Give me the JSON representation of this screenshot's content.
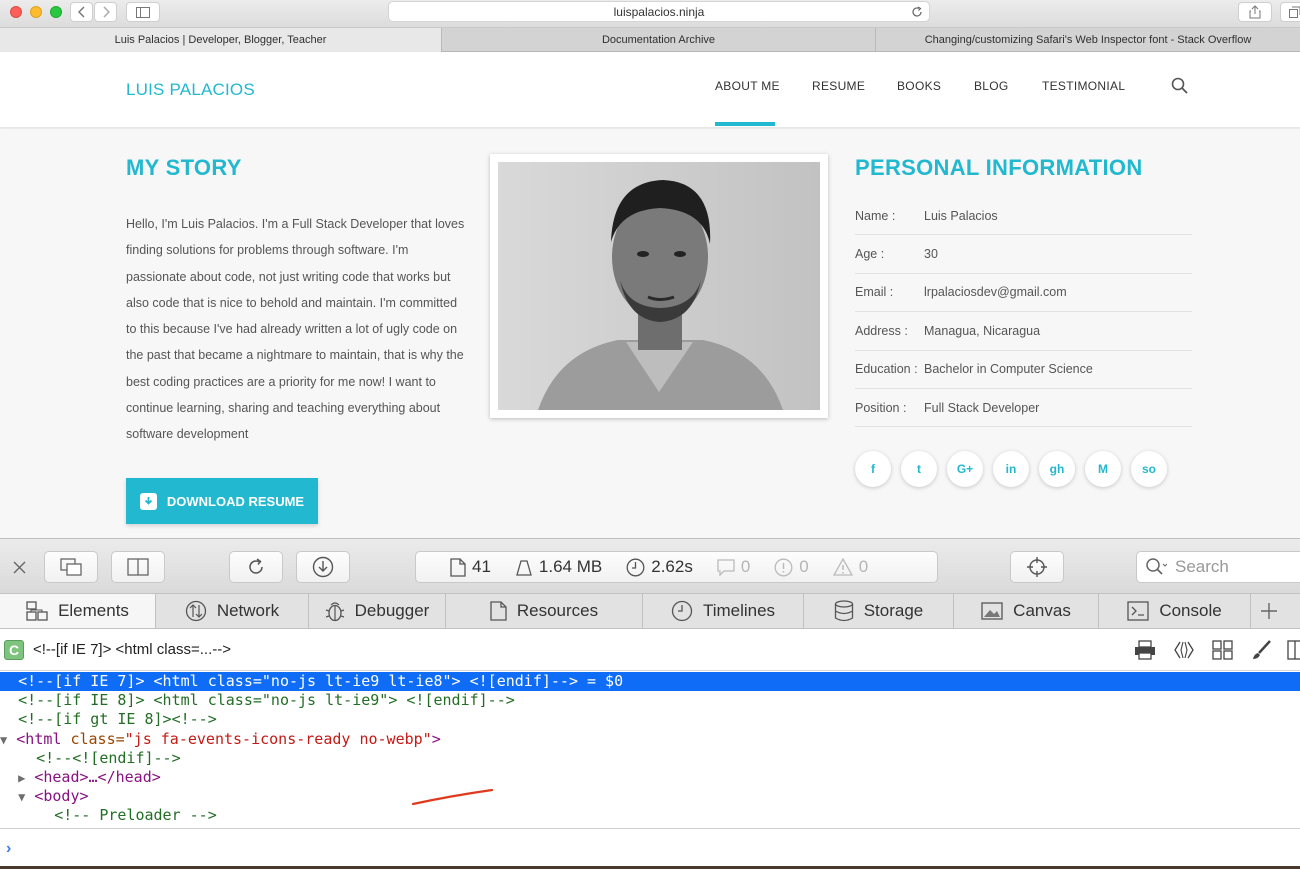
{
  "browser": {
    "url": "luispalacios.ninja",
    "tabs": [
      {
        "label": "Luis Palacios | Developer, Blogger, Teacher",
        "active": true
      },
      {
        "label": "Documentation Archive",
        "active": false
      },
      {
        "label": "Changing/customizing Safari's Web Inspector font - Stack Overflow",
        "active": false
      }
    ]
  },
  "site": {
    "brand": "LUIS PALACIOS",
    "nav": [
      "ABOUT ME",
      "RESUME",
      "BOOKS",
      "BLOG",
      "TESTIMONIAL"
    ],
    "active_nav": "ABOUT ME",
    "accent_color": "#22b8cf",
    "story": {
      "title": "MY STORY",
      "text": "Hello, I'm Luis Palacios. I'm a Full Stack Developer that loves finding solutions for problems through software. I'm passionate about code, not just writing code that works but also code that is nice to behold and maintain. I'm committed to this because I've had already written a lot of ugly code on the past that became a nightmare to maintain, that is why the best coding practices are a priority for me now! I want to continue learning, sharing and teaching everything about software development",
      "download_label": "DOWNLOAD RESUME"
    },
    "personal": {
      "title": "PERSONAL INFORMATION",
      "rows": [
        {
          "label": "Name :",
          "value": "Luis Palacios"
        },
        {
          "label": "Age :",
          "value": "30"
        },
        {
          "label": "Email :",
          "value": "lrpalaciosdev@gmail.com"
        },
        {
          "label": "Address :",
          "value": "Managua, Nicaragua"
        },
        {
          "label": "Education :",
          "value": "Bachelor in Computer Science"
        },
        {
          "label": "Position :",
          "value": "Full Stack Developer"
        }
      ],
      "social": [
        {
          "name": "facebook-icon",
          "glyph": "f"
        },
        {
          "name": "twitter-icon",
          "glyph": "t"
        },
        {
          "name": "google-plus-icon",
          "glyph": "G+"
        },
        {
          "name": "linkedin-icon",
          "glyph": "in"
        },
        {
          "name": "github-icon",
          "glyph": "gh"
        },
        {
          "name": "medium-icon",
          "glyph": "M"
        },
        {
          "name": "stackoverflow-icon",
          "glyph": "so"
        }
      ]
    }
  },
  "inspector": {
    "stats": {
      "resources": "41",
      "size": "1.64 MB",
      "time": "2.62s",
      "logs": "0",
      "errors": "0",
      "warnings": "0"
    },
    "search_placeholder": "Search",
    "tabs": [
      "Elements",
      "Network",
      "Debugger",
      "Resources",
      "Timelines",
      "Storage",
      "Canvas",
      "Console"
    ],
    "active_tab": "Elements",
    "breadcrumb": "<!--[if IE 7]> <html class=...-->",
    "dom": {
      "line1": "<!--[if IE 7]> <html class=\"no-js lt-ie9 lt-ie8\"> <![endif]--> = $0",
      "line2": "<!--[if IE 8]> <html class=\"no-js lt-ie9\"> <![endif]-->",
      "line3": "<!--[if gt IE 8]><!-->",
      "line4_tag_open": "<html",
      "line4_attr": " class=",
      "line4_val": "\"js fa-events-icons-ready no-webp\"",
      "line4_close": ">",
      "line5": "<!--<![endif]-->",
      "line6": "<head>…</head>",
      "line7": "<body>",
      "line8": "<!-- Preloader -->"
    }
  }
}
